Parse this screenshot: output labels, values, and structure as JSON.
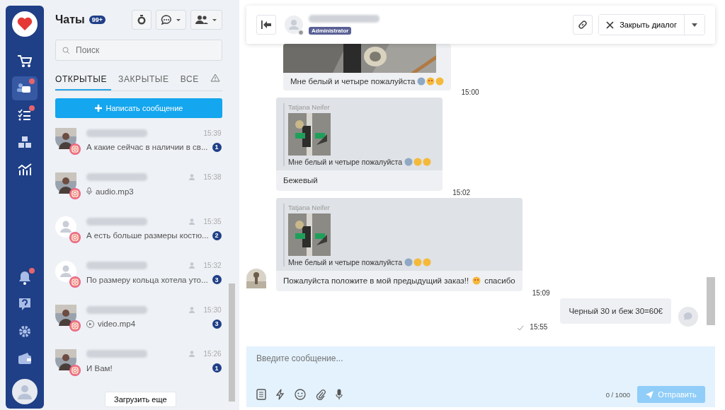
{
  "sidebar": {
    "items": [
      {
        "selected": false,
        "alert": false
      },
      {
        "selected": true,
        "alert": true
      },
      {
        "selected": false,
        "alert": true
      },
      {
        "selected": false,
        "alert": false
      },
      {
        "selected": false,
        "alert": false
      }
    ],
    "bottom_items": [
      {
        "alert": true
      },
      {
        "alert": false
      },
      {
        "alert": false
      },
      {
        "alert": false
      }
    ]
  },
  "chats": {
    "title": "Чаты",
    "badge": "99+",
    "search": {
      "placeholder": "Поиск"
    },
    "tabs": [
      {
        "label": "ОТКРЫТЫЕ",
        "selected": true
      },
      {
        "label": "ЗАКРЫТЫЕ",
        "selected": false
      },
      {
        "label": "ВСЕ",
        "selected": false
      }
    ],
    "new_message_button": "Написать сообщение",
    "items": [
      {
        "photo": true,
        "assigned": false,
        "time": "15:39",
        "preview": "А какие сейчас в наличии в св...",
        "kind": "text",
        "unread": "1"
      },
      {
        "photo": true,
        "assigned": true,
        "time": "15:38",
        "preview": "audio.mp3",
        "kind": "audio"
      },
      {
        "photo": false,
        "assigned": true,
        "time": "15:35",
        "preview": "А есть больше размеры костю...",
        "kind": "text",
        "unread": "2"
      },
      {
        "photo": false,
        "assigned": true,
        "time": "15:32",
        "preview": "По размеру кольца хотела уто...",
        "kind": "text",
        "unread": "3"
      },
      {
        "photo": true,
        "assigned": true,
        "time": "15:30",
        "preview": "video.mp4",
        "kind": "video",
        "unread": "3"
      },
      {
        "photo": true,
        "assigned": true,
        "time": "15:26",
        "preview": "И Вам!",
        "kind": "text",
        "unread": "1"
      }
    ],
    "load_more": "Загрузить еще"
  },
  "dialog": {
    "role_badge": "Administrator",
    "close_button": "Закрыть диалог",
    "messages": [
      {
        "text": "Мне белый и четыре пожалуйста",
        "emojis": true,
        "time": "15:00"
      },
      {
        "kind": "reply",
        "quote_author": "Tatjana Neifer",
        "quote_text": "Мне белый и четыре пожалуйста",
        "text": "Бежевый",
        "avatar": false,
        "time": "15:02"
      },
      {
        "kind": "reply",
        "quote_author": "Tatjana Neifer",
        "quote_text": "Мне белый и четыре пожалуйста",
        "text": "Пожалуйста положите в мой предыдущий заказ!!",
        "text_after": "спасибо",
        "avatar": true,
        "time": "15:09"
      },
      {
        "kind": "outgoing",
        "text": "Черный 30 и беж 30=60€",
        "read": true,
        "time": "15:55"
      }
    ],
    "composer": {
      "placeholder": "Введите сообщение...",
      "counter": "0 / 1000",
      "send_button": "Отправить"
    }
  }
}
